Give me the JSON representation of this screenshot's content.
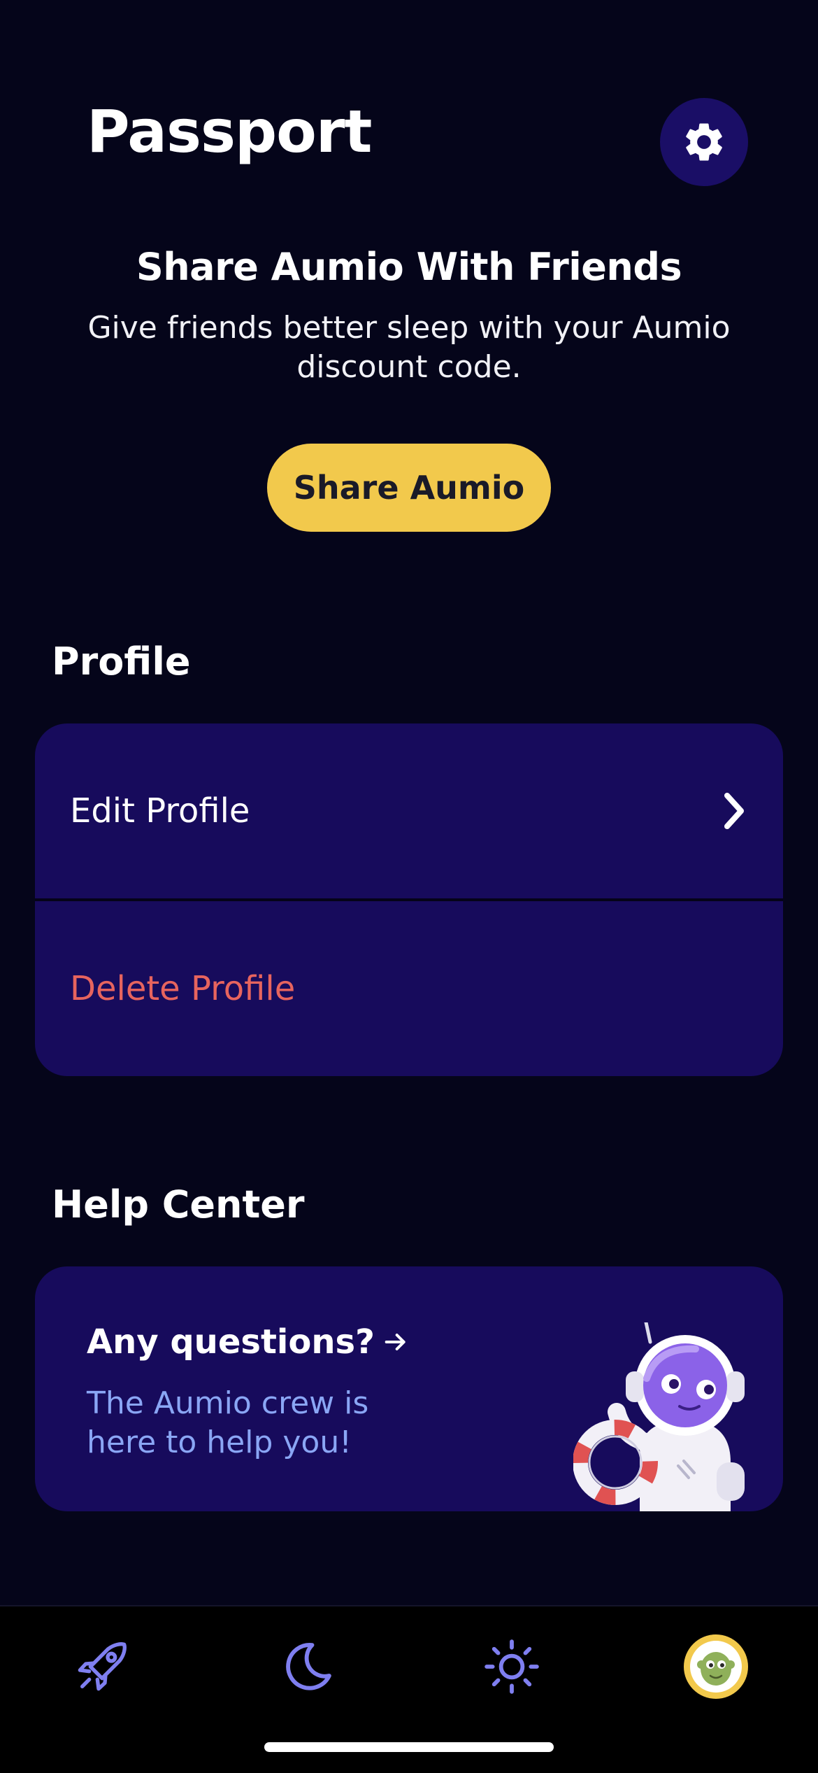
{
  "header": {
    "title": "Passport",
    "settings_icon": "gear-icon"
  },
  "share": {
    "title": "Share Aumio With Friends",
    "description": "Give friends better sleep with your Aumio discount code.",
    "button_label": "Share Aumio"
  },
  "profile": {
    "section_label": "Profile",
    "items": [
      {
        "label": "Edit Profile",
        "icon": "chevron-right-icon"
      },
      {
        "label": "Delete Profile",
        "color": "#e7645e"
      }
    ]
  },
  "help": {
    "section_label": "Help Center",
    "card_title": "Any questions?",
    "card_description": "The Aumio crew is here to help you!",
    "illustration": "astronaut-with-lifebuoy"
  },
  "tabbar": {
    "tabs": [
      {
        "icon": "rocket-icon"
      },
      {
        "icon": "moon-icon"
      },
      {
        "icon": "sun-icon"
      },
      {
        "icon": "avatar"
      }
    ]
  },
  "colors": {
    "background": "#05051a",
    "card": "#170b5c",
    "accent_yellow": "#f2c94c",
    "danger": "#e7645e",
    "help_text": "#8aa6f5",
    "tab_icon": "#7f7ff0"
  }
}
